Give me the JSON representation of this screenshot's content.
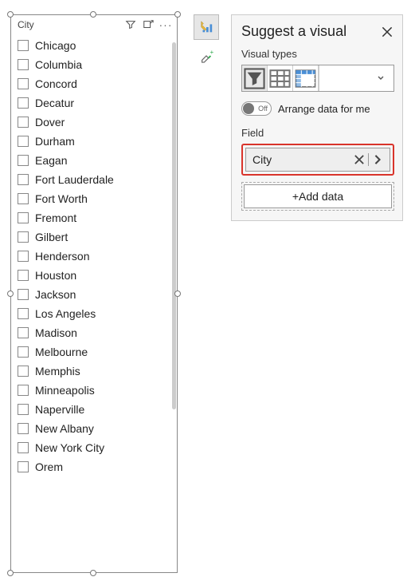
{
  "slicer": {
    "title": "City",
    "items": [
      "Chicago",
      "Columbia",
      "Concord",
      "Decatur",
      "Dover",
      "Durham",
      "Eagan",
      "Fort Lauderdale",
      "Fort Worth",
      "Fremont",
      "Gilbert",
      "Henderson",
      "Houston",
      "Jackson",
      "Los Angeles",
      "Madison",
      "Melbourne",
      "Memphis",
      "Minneapolis",
      "Naperville",
      "New Albany",
      "New York City",
      "Orem"
    ]
  },
  "suggest": {
    "title": "Suggest a visual",
    "visual_types_label": "Visual types",
    "arrange_label": "Arrange data for me",
    "arrange_state": "Off",
    "field_label": "Field",
    "field_name": "City",
    "add_data_label": "+Add data"
  }
}
